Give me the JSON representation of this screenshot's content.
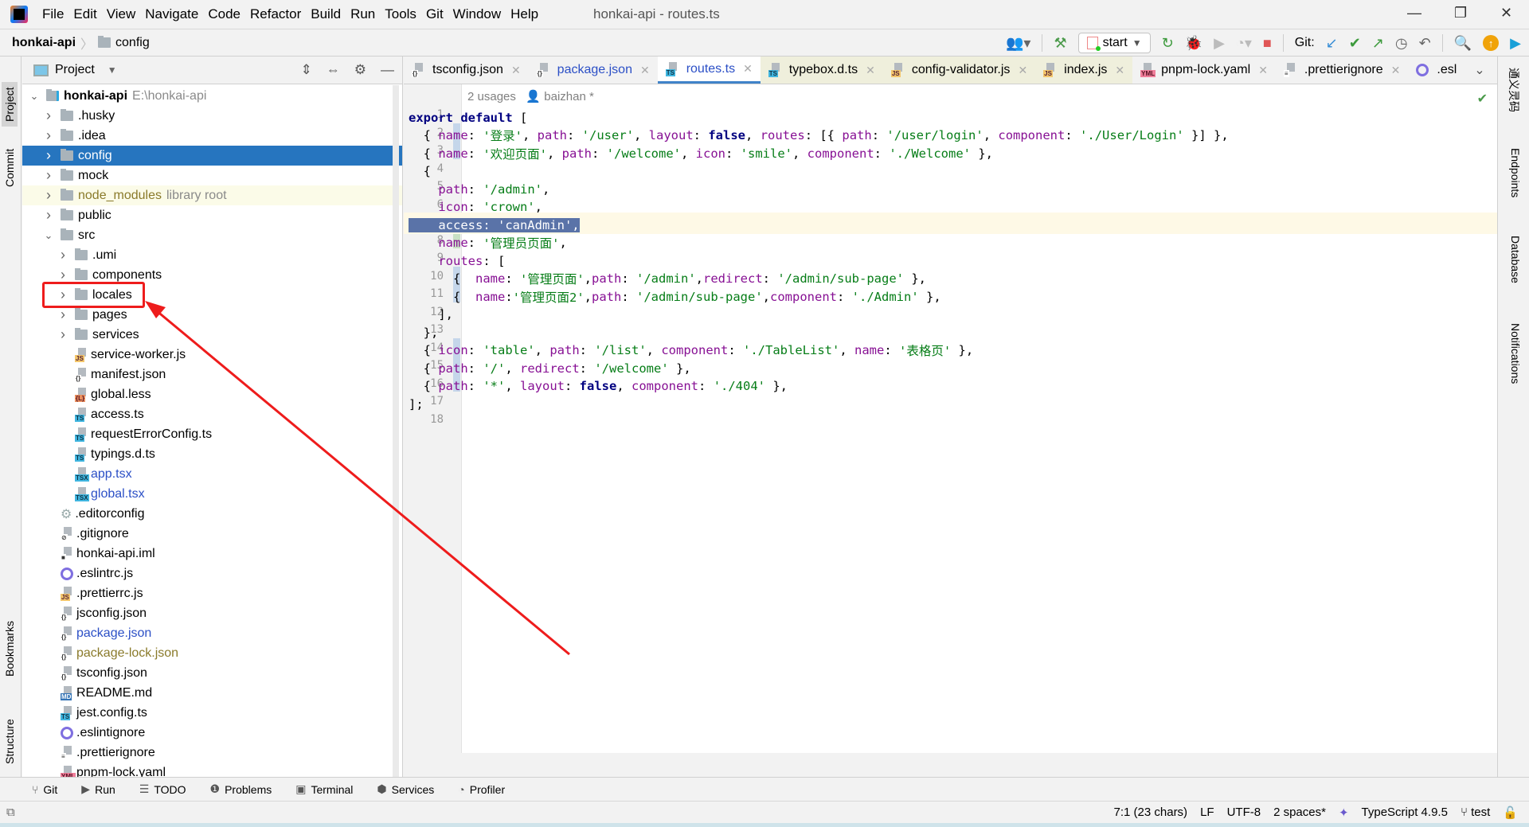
{
  "window": {
    "title": "honkai-api - routes.ts"
  },
  "menu": [
    "File",
    "Edit",
    "View",
    "Navigate",
    "Code",
    "Refactor",
    "Build",
    "Run",
    "Tools",
    "Git",
    "Window",
    "Help"
  ],
  "window_controls": {
    "minimize": "—",
    "restore": "❐",
    "close": "✕"
  },
  "breadcrumb": {
    "root": "honkai-api",
    "leaf": "config"
  },
  "toolbar": {
    "run_config": "start",
    "git_label": "Git:"
  },
  "project_panel": {
    "title": "Project",
    "root": {
      "name": "honkai-api",
      "path": "E:\\honkai-api"
    },
    "items": [
      {
        "name": ".husky",
        "type": "folder",
        "depth": 1,
        "expand": "collapsed"
      },
      {
        "name": ".idea",
        "type": "folder",
        "depth": 1,
        "expand": "collapsed"
      },
      {
        "name": "config",
        "type": "folder",
        "depth": 1,
        "expand": "collapsed",
        "selected": true
      },
      {
        "name": "mock",
        "type": "folder",
        "depth": 1,
        "expand": "collapsed"
      },
      {
        "name": "node_modules",
        "type": "folder",
        "depth": 1,
        "expand": "collapsed",
        "note": "library root"
      },
      {
        "name": "public",
        "type": "folder",
        "depth": 1,
        "expand": "collapsed"
      },
      {
        "name": "src",
        "type": "folder",
        "depth": 1,
        "expand": "expanded"
      },
      {
        "name": ".umi",
        "type": "folder",
        "depth": 2,
        "expand": "collapsed"
      },
      {
        "name": "components",
        "type": "folder",
        "depth": 2,
        "expand": "collapsed"
      },
      {
        "name": "locales",
        "type": "folder",
        "depth": 2,
        "expand": "collapsed",
        "highlighted": true
      },
      {
        "name": "pages",
        "type": "folder",
        "depth": 2,
        "expand": "collapsed"
      },
      {
        "name": "services",
        "type": "folder",
        "depth": 2,
        "expand": "collapsed"
      },
      {
        "name": "service-worker.js",
        "type": "js",
        "depth": 2
      },
      {
        "name": "manifest.json",
        "type": "json",
        "depth": 2
      },
      {
        "name": "global.less",
        "type": "less",
        "depth": 2
      },
      {
        "name": "access.ts",
        "type": "ts",
        "depth": 2
      },
      {
        "name": "requestErrorConfig.ts",
        "type": "ts",
        "depth": 2
      },
      {
        "name": "typings.d.ts",
        "type": "ts",
        "depth": 2
      },
      {
        "name": "app.tsx",
        "type": "tsx",
        "depth": 2,
        "color": "blue"
      },
      {
        "name": "global.tsx",
        "type": "tsx",
        "depth": 2,
        "color": "blue"
      },
      {
        "name": ".editorconfig",
        "type": "gear",
        "depth": 1
      },
      {
        "name": ".gitignore",
        "type": "ignore",
        "depth": 1
      },
      {
        "name": "honkai-api.iml",
        "type": "iml",
        "depth": 1
      },
      {
        "name": ".eslintrc.js",
        "type": "eslint",
        "depth": 1
      },
      {
        "name": ".prettierrc.js",
        "type": "js",
        "depth": 1
      },
      {
        "name": "jsconfig.json",
        "type": "json",
        "depth": 1
      },
      {
        "name": "package.json",
        "type": "json",
        "depth": 1,
        "color": "blue"
      },
      {
        "name": "package-lock.json",
        "type": "json",
        "depth": 1,
        "color": "olive"
      },
      {
        "name": "tsconfig.json",
        "type": "json",
        "depth": 1
      },
      {
        "name": "README.md",
        "type": "md",
        "depth": 1
      },
      {
        "name": "jest.config.ts",
        "type": "ts",
        "depth": 1
      },
      {
        "name": ".eslintignore",
        "type": "eslint",
        "depth": 1
      },
      {
        "name": ".prettierignore",
        "type": "text",
        "depth": 1
      },
      {
        "name": "pnpm-lock.yaml",
        "type": "yml",
        "depth": 1
      }
    ]
  },
  "editor_tabs": [
    {
      "label": "tsconfig.json",
      "type": "json"
    },
    {
      "label": "package.json",
      "type": "json",
      "color": "blue"
    },
    {
      "label": "routes.ts",
      "type": "ts",
      "active": true,
      "color": "blue"
    },
    {
      "label": "typebox.d.ts",
      "type": "ts",
      "tinted": true
    },
    {
      "label": "config-validator.js",
      "type": "js",
      "tinted": true
    },
    {
      "label": "index.js",
      "type": "js",
      "tinted": true
    },
    {
      "label": "pnpm-lock.yaml",
      "type": "yml"
    },
    {
      "label": ".prettierignore",
      "type": "text"
    },
    {
      "label": ".esl",
      "type": "eslint"
    }
  ],
  "editor": {
    "usages": "2 usages",
    "author": "baizhan *",
    "current_line": 7,
    "lines": [
      [
        [
          "kw",
          "export default "
        ],
        [
          "",
          "["
        ]
      ],
      [
        [
          "",
          "  { "
        ],
        [
          "prop",
          "name"
        ],
        [
          "",
          ": "
        ],
        [
          "str",
          "'登录'"
        ],
        [
          "",
          ", "
        ],
        [
          "prop",
          "path"
        ],
        [
          "",
          ": "
        ],
        [
          "str",
          "'/user'"
        ],
        [
          "",
          ", "
        ],
        [
          "prop",
          "layout"
        ],
        [
          "",
          ": "
        ],
        [
          "kw",
          "false"
        ],
        [
          "",
          ", "
        ],
        [
          "prop",
          "routes"
        ],
        [
          "",
          ": [{ "
        ],
        [
          "prop",
          "path"
        ],
        [
          "",
          ": "
        ],
        [
          "str",
          "'/user/login'"
        ],
        [
          "",
          ", "
        ],
        [
          "prop",
          "component"
        ],
        [
          "",
          ": "
        ],
        [
          "str",
          "'./User/Login'"
        ],
        [
          "",
          " }] },"
        ]
      ],
      [
        [
          "",
          "  { "
        ],
        [
          "prop",
          "name"
        ],
        [
          "",
          ": "
        ],
        [
          "str",
          "'欢迎页面'"
        ],
        [
          "",
          ", "
        ],
        [
          "prop",
          "path"
        ],
        [
          "",
          ": "
        ],
        [
          "str",
          "'/welcome'"
        ],
        [
          "",
          ", "
        ],
        [
          "prop",
          "icon"
        ],
        [
          "",
          ": "
        ],
        [
          "str",
          "'smile'"
        ],
        [
          "",
          ", "
        ],
        [
          "prop",
          "component"
        ],
        [
          "",
          ": "
        ],
        [
          "str",
          "'./Welcome'"
        ],
        [
          "",
          " },"
        ]
      ],
      [
        [
          "",
          "  {"
        ]
      ],
      [
        [
          "",
          "    "
        ],
        [
          "prop",
          "path"
        ],
        [
          "",
          ": "
        ],
        [
          "str",
          "'/admin'"
        ],
        [
          "",
          ","
        ]
      ],
      [
        [
          "",
          "    "
        ],
        [
          "prop",
          "icon"
        ],
        [
          "",
          ": "
        ],
        [
          "str",
          "'crown'"
        ],
        [
          "",
          ","
        ]
      ],
      [
        [
          "sel",
          "    access: 'canAdmin',"
        ]
      ],
      [
        [
          "",
          "    "
        ],
        [
          "prop",
          "name"
        ],
        [
          "",
          ": "
        ],
        [
          "str",
          "'管理员页面'"
        ],
        [
          "",
          ","
        ]
      ],
      [
        [
          "",
          "    "
        ],
        [
          "prop",
          "routes"
        ],
        [
          "",
          ": ["
        ]
      ],
      [
        [
          "",
          "      {  "
        ],
        [
          "prop",
          "name"
        ],
        [
          "",
          ": "
        ],
        [
          "str",
          "'管理页面'"
        ],
        [
          "",
          ","
        ],
        [
          "prop",
          "path"
        ],
        [
          "",
          ": "
        ],
        [
          "str",
          "'/admin'"
        ],
        [
          "",
          ","
        ],
        [
          "prop",
          "redirect"
        ],
        [
          "",
          ": "
        ],
        [
          "str",
          "'/admin/sub-page'"
        ],
        [
          "",
          " },"
        ]
      ],
      [
        [
          "",
          "      {  "
        ],
        [
          "prop",
          "name"
        ],
        [
          "",
          ":"
        ],
        [
          "str",
          "'管理页面2'"
        ],
        [
          "",
          ","
        ],
        [
          "prop",
          "path"
        ],
        [
          "",
          ": "
        ],
        [
          "str",
          "'/admin/sub-page'"
        ],
        [
          "",
          ","
        ],
        [
          "prop",
          "component"
        ],
        [
          "",
          ": "
        ],
        [
          "str",
          "'./Admin'"
        ],
        [
          "",
          " },"
        ]
      ],
      [
        [
          "",
          "    ],"
        ]
      ],
      [
        [
          "",
          "  },"
        ]
      ],
      [
        [
          "",
          "  { "
        ],
        [
          "prop",
          "icon"
        ],
        [
          "",
          ": "
        ],
        [
          "str",
          "'table'"
        ],
        [
          "",
          ", "
        ],
        [
          "prop",
          "path"
        ],
        [
          "",
          ": "
        ],
        [
          "str",
          "'/list'"
        ],
        [
          "",
          ", "
        ],
        [
          "prop",
          "component"
        ],
        [
          "",
          ": "
        ],
        [
          "str",
          "'./TableList'"
        ],
        [
          "",
          ", "
        ],
        [
          "prop",
          "name"
        ],
        [
          "",
          ": "
        ],
        [
          "str",
          "'表格页'"
        ],
        [
          "",
          " },"
        ]
      ],
      [
        [
          "",
          "  { "
        ],
        [
          "prop",
          "path"
        ],
        [
          "",
          ": "
        ],
        [
          "str",
          "'/'"
        ],
        [
          "",
          ", "
        ],
        [
          "prop",
          "redirect"
        ],
        [
          "",
          ": "
        ],
        [
          "str",
          "'/welcome'"
        ],
        [
          "",
          " },"
        ]
      ],
      [
        [
          "",
          "  { "
        ],
        [
          "prop",
          "path"
        ],
        [
          "",
          ": "
        ],
        [
          "str",
          "'*'"
        ],
        [
          "",
          ", "
        ],
        [
          "prop",
          "layout"
        ],
        [
          "",
          ": "
        ],
        [
          "kw",
          "false"
        ],
        [
          "",
          ", "
        ],
        [
          "prop",
          "component"
        ],
        [
          "",
          ": "
        ],
        [
          "str",
          "'./404'"
        ],
        [
          "",
          " },"
        ]
      ],
      [
        [
          "",
          "];"
        ]
      ],
      [
        [
          "",
          ""
        ]
      ]
    ]
  },
  "left_stripe": [
    "Project",
    "Commit",
    "Bookmarks",
    "Structure"
  ],
  "right_stripe": [
    "通义灵码",
    "Endpoints",
    "Database",
    "Notifications"
  ],
  "bottom_tools": [
    "Git",
    "Run",
    "TODO",
    "Problems",
    "Terminal",
    "Services",
    "Profiler"
  ],
  "status": {
    "position": "7:1 (23 chars)",
    "line_sep": "LF",
    "encoding": "UTF-8",
    "indent": "2 spaces*",
    "language": "TypeScript 4.9.5",
    "branch": "test"
  },
  "colors": {
    "selection": "#2675bf",
    "annotation": "#ee1c1c",
    "accent": "#4083c9"
  }
}
